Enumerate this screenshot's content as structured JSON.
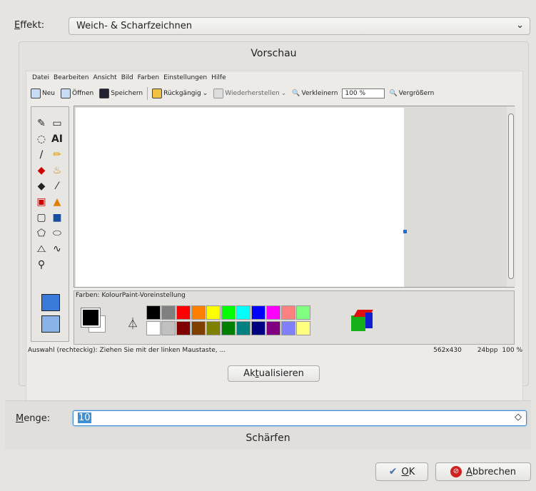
{
  "effect": {
    "label_prefix": "",
    "label_mnemonic": "E",
    "label_rest": "ffekt:",
    "value": "Weich- & Scharfzeichnen"
  },
  "preview": {
    "title": "Vorschau",
    "menubar": [
      "Datei",
      "Bearbeiten",
      "Ansicht",
      "Bild",
      "Farben",
      "Einstellungen",
      "Hilfe"
    ],
    "toolbar": {
      "new": "Neu",
      "open": "Öffnen",
      "save": "Speichern",
      "undo": "Rückgängig",
      "redo": "Wiederherstellen",
      "zoom_out": "Verkleinern",
      "zoom_value": "100 %",
      "zoom_in": "Vergrößern"
    },
    "color_box_title": "Farben: KolourPaint-Voreinstellung",
    "status_text": "Auswahl (rechteckig): Ziehen Sie mit der linken Maustaste, ...",
    "status_size": "562x430",
    "status_depth": "24bpp",
    "status_zoom": "100 %",
    "palette_top": [
      "#000000",
      "#808080",
      "#ff0000",
      "#ff8000",
      "#ffff00",
      "#00ff00",
      "#00ffff",
      "#0000ff",
      "#ff00ff",
      "#ff8080",
      "#80ff80"
    ],
    "palette_bottom": [
      "#ffffff",
      "#c0c0c0",
      "#800000",
      "#804000",
      "#808000",
      "#008000",
      "#008080",
      "#000080",
      "#800080",
      "#8080ff",
      "#ffff80"
    ]
  },
  "refresh_button": {
    "pre": "Ak",
    "mnemonic": "t",
    "post": "ualisieren"
  },
  "amount": {
    "label_mnemonic": "M",
    "label_rest": "enge:",
    "value": "10",
    "caption": "Schärfen"
  },
  "ok_button": {
    "mnemonic": "O",
    "rest": "K"
  },
  "cancel_button": {
    "mnemonic": "A",
    "rest": "bbrechen"
  }
}
